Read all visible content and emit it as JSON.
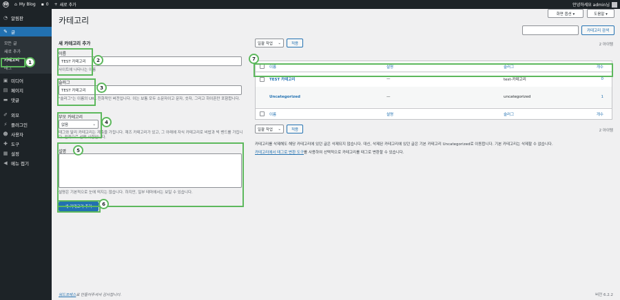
{
  "adminbar": {
    "site_name": "My Blog",
    "comments_count": "0",
    "new_label": "새로 추가",
    "greeting": "안녕하세요 admin님"
  },
  "sidebar": {
    "items": [
      {
        "label": "알림판",
        "icon": "dashboard-icon"
      },
      {
        "label": "글",
        "icon": "pin-icon",
        "active": true
      },
      {
        "label": "미디어",
        "icon": "media-icon"
      },
      {
        "label": "페이지",
        "icon": "page-icon"
      },
      {
        "label": "댓글",
        "icon": "comment-icon"
      },
      {
        "label": "외모",
        "icon": "brush-icon"
      },
      {
        "label": "플러그인",
        "icon": "plugin-icon"
      },
      {
        "label": "사용자",
        "icon": "user-icon"
      },
      {
        "label": "도구",
        "icon": "wrench-icon"
      },
      {
        "label": "설정",
        "icon": "settings-icon"
      },
      {
        "label": "메뉴 접기",
        "icon": "collapse-icon"
      }
    ],
    "submenu": [
      "모든 글",
      "새로 추가",
      "카테고리",
      "태그"
    ]
  },
  "header": {
    "title": "카테고리",
    "screen_options": "화면 옵션 ▾",
    "help": "도움말 ▾",
    "search_button": "카테고리 검색"
  },
  "form": {
    "section_title": "새 카테고리 추가",
    "name_label": "이름",
    "name_value": "TEST 카테고리",
    "name_help": "사이트에 나타나는 이름",
    "slug_label": "슬러그",
    "slug_value": "TEST 카테고리",
    "slug_help": "\"슬러그\"는 이름의 URL 친화적인 버전입니다. 이는 보통 모두 소문자이고 문자, 숫자, 그리고 하이픈만 포함합니다.",
    "parent_label": "부모 카테고리",
    "parent_value": "없음",
    "parent_help": "태그와 달리 카테고리는 계층을 가집니다. 재즈 카테고리가 있고, 그 아래에 자식 카테고리로 비밥과 빅 밴드를 가집니다. 전적으로 선택 사항입니다.",
    "desc_label": "설명",
    "desc_help": "설명은 기본적으로 눈에 띄지는 않습니다. 하지만, 일부 테마에서는 보일 수 있습니다.",
    "submit": "새 카테고리 추가"
  },
  "list": {
    "bulk_label": "일괄 작업",
    "apply_label": "적용",
    "item_count": "2 아이템",
    "columns": {
      "name": "이름",
      "description": "설명",
      "slug": "슬러그",
      "count": "개수"
    },
    "rows": [
      {
        "name": "TEST 카테고리",
        "description": "—",
        "slug": "test-카테고리",
        "count": "0"
      },
      {
        "name": "Uncategorized",
        "description": "—",
        "slug": "uncategorized",
        "count": "1"
      }
    ],
    "note1": "카테고리를 삭제해도 해당 카테고리에 있던 글은 삭제되지 않습니다. 대신, 삭제된 카테고리에 있던 글은 기본 카테고리 Uncategorized로 이동합니다. 기본 카테고리는 삭제할 수 없습니다.",
    "note2_link": "카테고리에서 태그로 변환 도구",
    "note2_rest": "를 사용하여 선택적으로 카테고리를 태그로 변환할 수 있습니다."
  },
  "footer": {
    "thanks_link": "워드프레스",
    "thanks_rest": "로 만들어주셔서 감사합니다.",
    "version": "버전 6.2.2"
  },
  "badges": [
    "1",
    "2",
    "3",
    "4",
    "5",
    "6",
    "7"
  ],
  "colors": {
    "accent": "#2271b1",
    "highlight": "#5cb85c",
    "sidebar": "#1d2327"
  }
}
